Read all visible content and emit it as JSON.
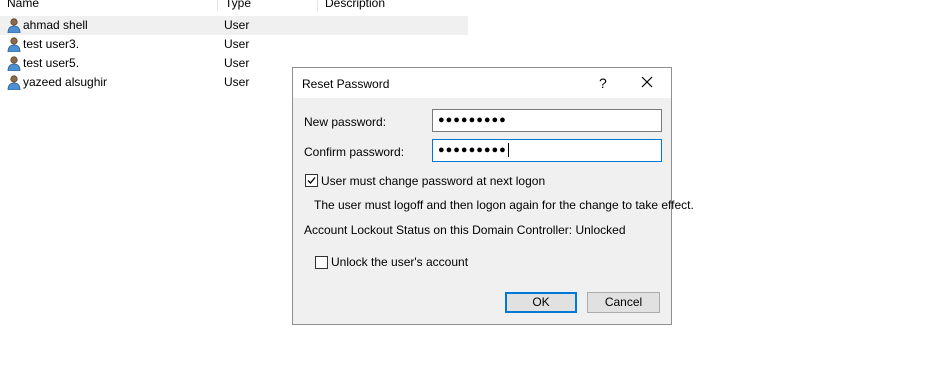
{
  "listview": {
    "columns": [
      "Name",
      "Type",
      "Description"
    ],
    "rows": [
      {
        "name": "ahmad shell",
        "type": "User",
        "description": "",
        "icon": "user-icon",
        "selected": true
      },
      {
        "name": "test user3.",
        "type": "User",
        "description": "",
        "icon": "user-icon"
      },
      {
        "name": "test user5.",
        "type": "User",
        "description": "",
        "icon": "user-icon"
      },
      {
        "name": "yazeed alsughir",
        "type": "User",
        "description": "",
        "icon": "user-icon"
      }
    ]
  },
  "dialog": {
    "title": "Reset Password",
    "help_glyph": "?",
    "close_icon": "close-icon",
    "new_password_label": "New password:",
    "new_password_value": "●●●●●●●●●",
    "confirm_password_label": "Confirm password:",
    "confirm_password_value": "●●●●●●●●●",
    "must_change_label": "User must change password at next logon",
    "must_change_checked": true,
    "note": "The user must logoff and then logon again for the change to take effect.",
    "lockout_status": "Account Lockout Status on this Domain Controller: Unlocked",
    "unlock_label": "Unlock the user's account",
    "unlock_checked": false,
    "ok_label": "OK",
    "cancel_label": "Cancel",
    "accent_color": "#0078d7"
  }
}
